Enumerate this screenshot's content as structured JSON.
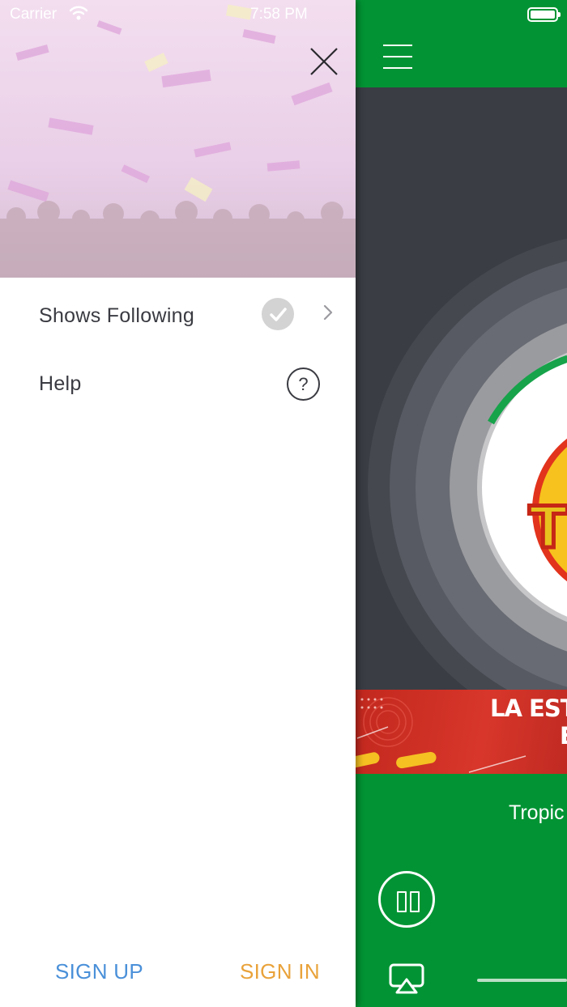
{
  "status_bar": {
    "carrier": "Carrier",
    "time": "7:58 PM"
  },
  "drawer": {
    "menu": [
      {
        "label": "Shows Following",
        "icon": "check-circle-icon",
        "trailing": "chevron-right-icon"
      },
      {
        "label": "Help",
        "icon": "question-circle-icon"
      }
    ],
    "sign_up_label": "SIGN UP",
    "sign_in_label": "SIGN IN"
  },
  "player": {
    "banner_text_line1": "LA ESTA",
    "banner_text_line2": "E",
    "station_name": "Tropic",
    "logo_text": "TR"
  },
  "colors": {
    "brand_green": "#029434",
    "sign_up": "#4a90d9",
    "sign_in": "#e9a23a",
    "banner_red": "#d8362a"
  }
}
